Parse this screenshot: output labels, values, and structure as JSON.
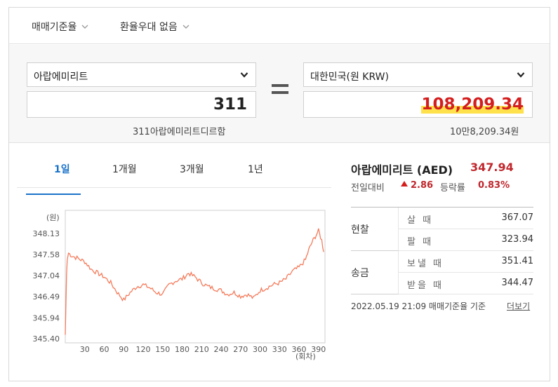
{
  "topbar": {
    "rate_type": "매매기준율",
    "preference": "환율우대 없음"
  },
  "converter": {
    "from_currency": "아랍에미리트",
    "from_amount": "311",
    "from_reading": "311아랍에미리트디르함",
    "to_currency": "대한민국(원 KRW)",
    "to_amount": "108,209.34",
    "to_reading": "10만8,209.34원"
  },
  "tabs": [
    {
      "label": "1일"
    },
    {
      "label": "1개월"
    },
    {
      "label": "3개월"
    },
    {
      "label": "1년"
    }
  ],
  "info": {
    "title": "아랍에미리트 (AED)",
    "rate": "347.94",
    "change_label": "전일대비",
    "change_value": "2.86",
    "ratio_label": "등락률",
    "ratio_value": "0.83%"
  },
  "rates": {
    "cash_label": "현찰",
    "remit_label": "송금",
    "buy_cash_label": "살 때",
    "buy_cash": "367.07",
    "sell_cash_label": "팔 때",
    "sell_cash": "323.94",
    "send_label": "보낼 때",
    "send": "351.41",
    "receive_label": "받을 때",
    "receive": "344.47"
  },
  "footer": {
    "basis": "2022.05.19 21:09 매매기준율 기준",
    "more": "더보기"
  },
  "colors": {
    "accent_blue": "#1a73c9",
    "up_red": "#c0272d",
    "line_orange": "#f47b5b",
    "highlight_yellow": "#ffe14b"
  },
  "chart_data": {
    "type": "line",
    "ylabel": "(원)",
    "xlabel": "(회차)",
    "yticks": [
      "348.13",
      "347.58",
      "347.04",
      "346.49",
      "345.94",
      "345.40"
    ],
    "xticks": [
      "30",
      "60",
      "90",
      "120",
      "150",
      "180",
      "210",
      "240",
      "270",
      "300",
      "330",
      "360",
      "390"
    ],
    "ylim": [
      345.4,
      348.13
    ],
    "xlim": [
      0,
      400
    ],
    "grid": false,
    "series": [
      {
        "x": [
          0,
          2,
          3,
          5,
          10,
          20,
          30,
          40,
          50,
          60,
          70,
          80,
          90,
          100,
          110,
          120,
          130,
          140,
          150,
          160,
          170,
          180,
          190,
          200,
          210,
          220,
          230,
          240,
          250,
          260,
          270,
          280,
          290,
          300,
          310,
          320,
          330,
          340,
          350,
          360,
          370,
          375,
          380,
          385,
          390,
          395,
          398
        ],
        "y": [
          345.5,
          347.05,
          347.45,
          347.62,
          347.55,
          347.48,
          347.4,
          347.2,
          347.1,
          347.0,
          346.85,
          346.6,
          346.4,
          346.6,
          346.75,
          346.8,
          346.72,
          346.6,
          346.55,
          346.8,
          346.9,
          346.95,
          347.1,
          347.0,
          346.85,
          346.75,
          346.7,
          346.65,
          346.55,
          346.6,
          346.5,
          346.55,
          346.45,
          346.65,
          346.72,
          346.8,
          346.85,
          346.95,
          347.15,
          347.25,
          347.45,
          347.7,
          347.9,
          348.05,
          348.2,
          347.95,
          347.65
        ]
      }
    ]
  }
}
